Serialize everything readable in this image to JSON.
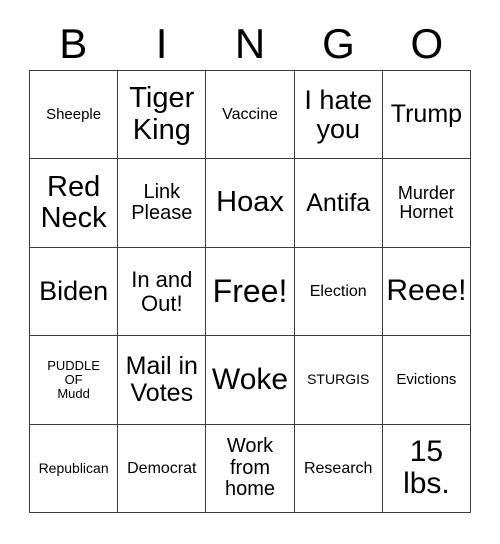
{
  "card": {
    "header_letters": [
      "B",
      "I",
      "N",
      "G",
      "O"
    ],
    "border_color": "#3b3b3b",
    "text_color": "#000000",
    "background_color": "#ffffff",
    "rows": 5,
    "columns": 5
  },
  "grid": {
    "rows": [
      {
        "cells": [
          {
            "text": "Sheeple",
            "size": "fs-15"
          },
          {
            "text": "Tiger\nKing",
            "size": "fs-29"
          },
          {
            "text": "Vaccine",
            "size": "fs-16"
          },
          {
            "text": "I hate\nyou",
            "size": "fs-27"
          },
          {
            "text": "Trump",
            "size": "fs-25"
          }
        ]
      },
      {
        "cells": [
          {
            "text": "Red\nNeck",
            "size": "fs-29"
          },
          {
            "text": "Link\nPlease",
            "size": "fs-20"
          },
          {
            "text": "Hoax",
            "size": "fs-29"
          },
          {
            "text": "Antifa",
            "size": "fs-25"
          },
          {
            "text": "Murder\nHornet",
            "size": "fs-18"
          }
        ]
      },
      {
        "cells": [
          {
            "text": "Biden",
            "size": "fs-27"
          },
          {
            "text": "In and\nOut!",
            "size": "fs-22"
          },
          {
            "text": "Free!",
            "size": "fs-32"
          },
          {
            "text": "Election",
            "size": "fs-16"
          },
          {
            "text": "Reee!",
            "size": "fs-30"
          }
        ]
      },
      {
        "cells": [
          {
            "text": "PUDDLE\nOF\nMudd",
            "size": "fs-13"
          },
          {
            "text": "Mail in\nVotes",
            "size": "fs-25"
          },
          {
            "text": "Woke",
            "size": "fs-30"
          },
          {
            "text": "STURGIS",
            "size": "fs-14"
          },
          {
            "text": "Evictions",
            "size": "fs-15"
          }
        ]
      },
      {
        "cells": [
          {
            "text": "Republican",
            "size": "fs-14"
          },
          {
            "text": "Democrat",
            "size": "fs-16"
          },
          {
            "text": "Work\nfrom\nhome",
            "size": "fs-20"
          },
          {
            "text": "Research",
            "size": "fs-16"
          },
          {
            "text": "15\nlbs.",
            "size": "fs-30"
          }
        ]
      }
    ]
  }
}
